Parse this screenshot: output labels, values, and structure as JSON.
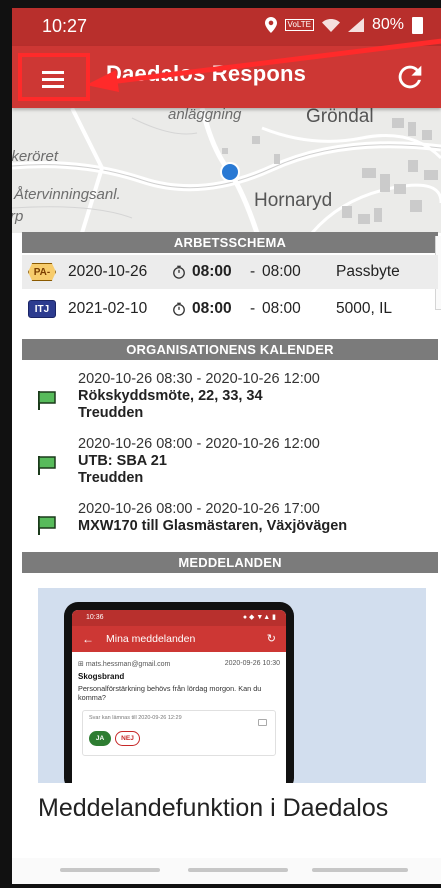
{
  "status_bar": {
    "time": "10:27",
    "net_label": "VoLTE",
    "battery": "80%"
  },
  "app_bar": {
    "title": "Daedalos Respons",
    "menu_icon": "hamburger-menu-icon",
    "refresh_icon": "refresh-icon"
  },
  "map": {
    "labels": [
      "anläggning",
      "Gröndal",
      "ikeröret",
      "Återvinningsanl.",
      "Hornaryd",
      "rp"
    ]
  },
  "schedule": {
    "header": "ARBETSSCHEMA",
    "rows": [
      {
        "badge": "PA-",
        "date": "2020-10-26",
        "start": "08:00",
        "dash": "-",
        "end": "08:00",
        "desc": "Passbyte"
      },
      {
        "badge": "ITJ",
        "date": "2021-02-10",
        "start": "08:00",
        "dash": "-",
        "end": "08:00",
        "desc": "5000, IL"
      }
    ]
  },
  "calendar": {
    "header": "ORGANISATIONENS KALENDER",
    "items": [
      {
        "time": "2020-10-26 08:30 - 2020-10-26 12:00",
        "title": "Rökskyddsmöte, 22, 33, 34",
        "place": "Treudden"
      },
      {
        "time": "2020-10-26 08:00 - 2020-10-26 12:00",
        "title": "UTB: SBA 21",
        "place": "Treudden"
      },
      {
        "time": "2020-10-26 08:00 - 2020-10-26 17:00",
        "title": "MXW170 till Glasmästaren, Växjövägen",
        "place": ""
      }
    ]
  },
  "messages": {
    "header": "MEDDELANDEN",
    "title": "Meddelandefunktion i Daedalos",
    "preview": {
      "status_time": "10:36",
      "app_title": "Mina meddelanden",
      "sender": "mats.hessman@gmail.com",
      "sent": "2020-09-26 10:30",
      "subject": "Skogsbrand",
      "body": "Personalförstärkning behövs från lördag morgon. Kan du komma?",
      "reply_hint": "Svar kan lämnas till 2020-09-26 12:29",
      "yes": "JA",
      "no": "NEJ"
    }
  },
  "colors": {
    "app_bar": "#cd3734",
    "status_bar": "#b82f2c",
    "section_header": "#7b7b7b",
    "annotation": "#ff2a2a",
    "flag": "#4caf50"
  }
}
